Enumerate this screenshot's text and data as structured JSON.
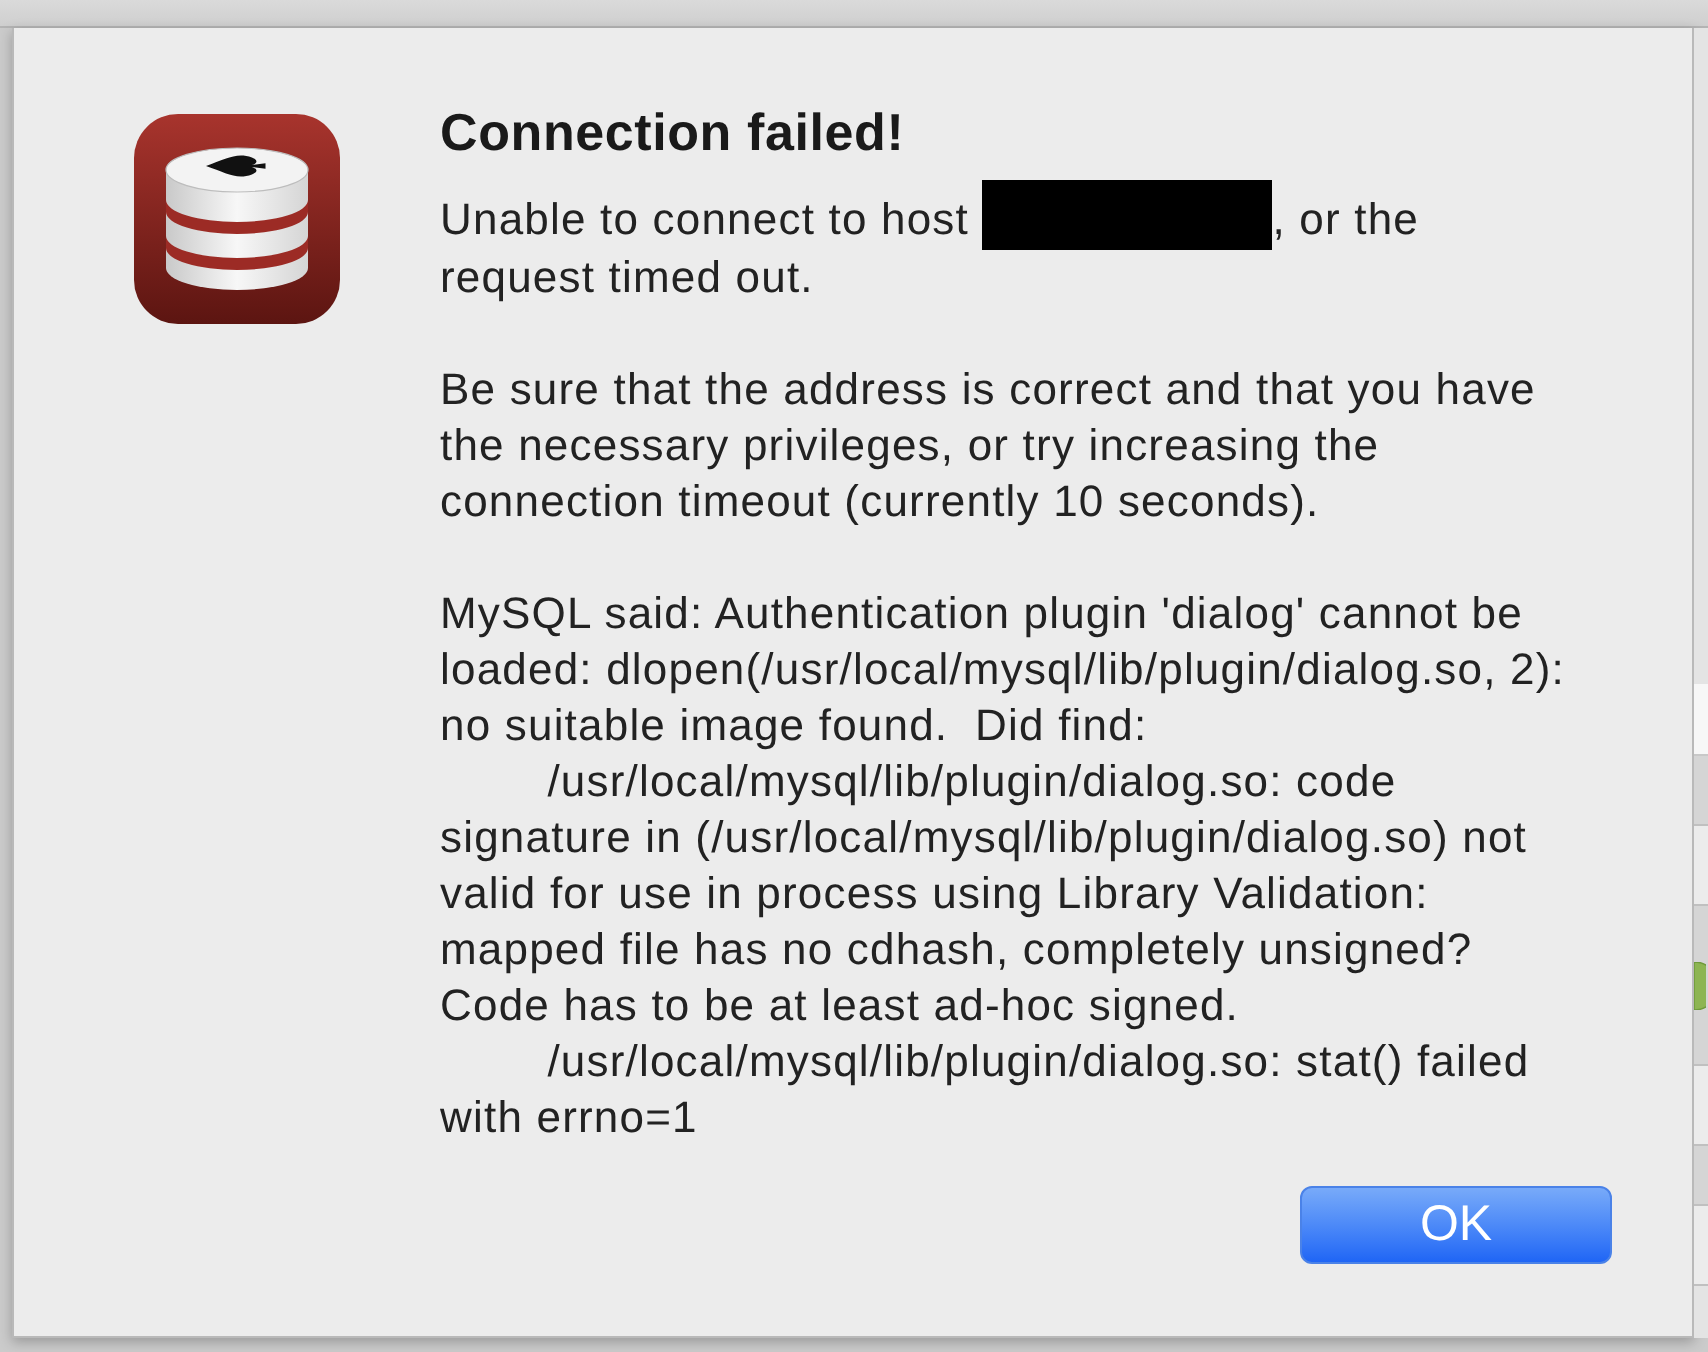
{
  "dialog": {
    "title": "Connection failed!",
    "paragraphs": [
      {
        "segments": [
          {
            "kind": "text",
            "text": "Unable to connect to host "
          },
          {
            "kind": "redacted"
          },
          {
            "kind": "text",
            "text": ", or the request timed out."
          }
        ]
      },
      {
        "segments": [
          {
            "kind": "text",
            "text": "Be sure that the address is correct and that you have the necessary privileges, or try increasing the connection timeout (currently 10 seconds)."
          }
        ]
      },
      {
        "segments": [
          {
            "kind": "text",
            "text": "MySQL said: Authentication plugin 'dialog' cannot be loaded: dlopen(/usr/local/mysql/lib/plugin/dialog.so, 2): no suitable image found.  Did find:\n\t/usr/local/mysql/lib/plugin/dialog.so: code signature in (/usr/local/mysql/lib/plugin/dialog.so) not valid for use in process using Library Validation: mapped file has no cdhash, completely unsigned? Code has to be at least ad-hoc signed.\n\t/usr/local/mysql/lib/plugin/dialog.so: stat() failed with errno=1"
          }
        ]
      }
    ],
    "buttons": [
      {
        "label": "OK",
        "default": true
      }
    ]
  }
}
